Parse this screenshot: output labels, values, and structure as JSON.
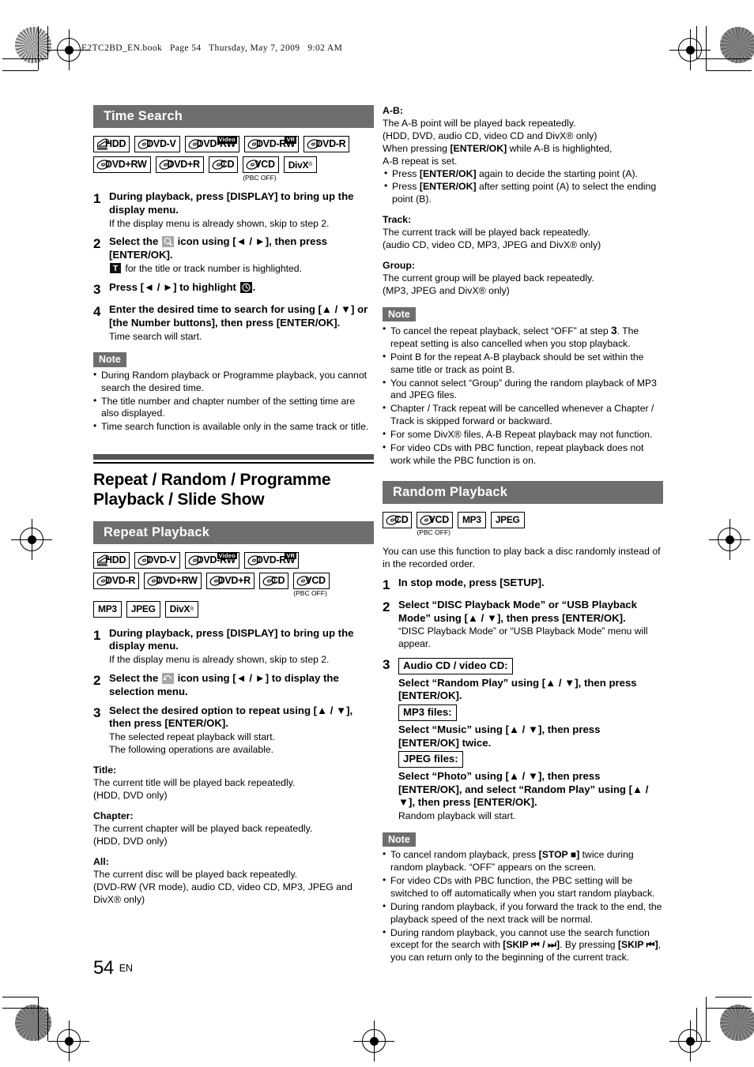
{
  "page": {
    "book_header": "E2TC2BD_EN.book   Page 54   Thursday, May 7, 2009   9:02 AM",
    "number": "54",
    "language": "EN"
  },
  "left_column": {
    "time_search": {
      "heading": "Time Search",
      "badges": [
        [
          {
            "type": "hdd",
            "label": "HDD"
          },
          {
            "type": "disc",
            "label": "DVD-V"
          },
          {
            "type": "disc",
            "label": "DVD-RW",
            "sup": "Video"
          },
          {
            "type": "disc",
            "label": "DVD-RW",
            "sup": "VR"
          },
          {
            "type": "disc",
            "label": "DVD-R"
          }
        ],
        [
          {
            "type": "disc",
            "label": "DVD+RW"
          },
          {
            "type": "disc",
            "label": "DVD+R"
          },
          {
            "type": "disc",
            "label": "CD"
          },
          {
            "type": "disc",
            "label": "VCD",
            "note": "(PBC OFF)"
          },
          {
            "type": "text",
            "label": "DivX",
            "reg": true
          }
        ]
      ],
      "steps": [
        {
          "num": "1",
          "lead": "During playback, press [DISPLAY] to bring up the display menu.",
          "sub": "If the display menu is already shown, skip to step 2."
        },
        {
          "num": "2",
          "lead_pre": "Select the ",
          "icon": "search-icon",
          "lead_post": " icon using [◄ / ►], then press [ENTER/OK].",
          "sub_icon": "title-t-icon",
          "sub_post": " for the title or track number is highlighted."
        },
        {
          "num": "3",
          "lead_pre": "Press [◄ / ►] to highlight ",
          "icon": "clock-icon",
          "lead_post": "."
        },
        {
          "num": "4",
          "lead": "Enter the desired time to search for using [▲ / ▼] or [the Number buttons], then press [ENTER/OK].",
          "sub": "Time search will start."
        }
      ],
      "note_label": "Note",
      "notes": [
        "During Random playback or Programme playback, you cannot search the desired time.",
        "The title number and chapter number of the setting time are also displayed.",
        "Time search function is available only in the same track or title."
      ]
    },
    "chapter": {
      "title": "Repeat / Random / Programme Playback / Slide Show"
    },
    "repeat_playback": {
      "heading": "Repeat Playback",
      "badges": [
        [
          {
            "type": "hdd",
            "label": "HDD"
          },
          {
            "type": "disc",
            "label": "DVD-V"
          },
          {
            "type": "disc",
            "label": "DVD-RW",
            "sup": "Video"
          },
          {
            "type": "disc",
            "label": "DVD-RW",
            "sup": "VR"
          }
        ],
        [
          {
            "type": "disc",
            "label": "DVD-R"
          },
          {
            "type": "disc",
            "label": "DVD+RW"
          },
          {
            "type": "disc",
            "label": "DVD+R"
          },
          {
            "type": "disc",
            "label": "CD"
          },
          {
            "type": "disc",
            "label": "VCD",
            "note": "(PBC OFF)"
          }
        ],
        [
          {
            "type": "text",
            "label": "MP3"
          },
          {
            "type": "text",
            "label": "JPEG"
          },
          {
            "type": "text",
            "label": "DivX",
            "reg": true
          }
        ]
      ],
      "steps": [
        {
          "num": "1",
          "lead": "During playback, press [DISPLAY] to bring up the display menu.",
          "sub": "If the display menu is already shown, skip to step 2."
        },
        {
          "num": "2",
          "lead_pre": "Select the ",
          "icon": "repeat-icon",
          "lead_post": " icon using [◄ / ►] to display the selection menu."
        },
        {
          "num": "3",
          "lead": "Select the desired option to repeat using [▲ / ▼], then press [ENTER/OK].",
          "sub": "The selected repeat playback will start.\nThe following operations are available."
        }
      ],
      "definitions": [
        {
          "term": "Title:",
          "desc": "The current title will be played back repeatedly.\n(HDD, DVD only)"
        },
        {
          "term": "Chapter:",
          "desc": "The current chapter will be played back repeatedly.\n(HDD, DVD only)"
        },
        {
          "term": "All:",
          "desc": "The current disc will be played back repeatedly.\n(DVD-RW (VR mode), audio CD, video CD, MP3, JPEG and DivX® only)"
        }
      ]
    }
  },
  "right_column": {
    "ab_section": {
      "term": "A-B:",
      "lines": [
        "The A-B point will be played back repeatedly.",
        "(HDD, DVD, audio CD, video CD and DivX® only)",
        "When pressing [ENTER/OK] while A-B is highlighted,",
        "A-B repeat is set."
      ],
      "bullets": [
        "Press [ENTER/OK] again to decide the starting point (A).",
        "Press [ENTER/OK] after setting point (A) to select the ending point (B)."
      ]
    },
    "track_section": {
      "term": "Track:",
      "desc": "The current track will be played back repeatedly.\n(audio CD, video CD, MP3, JPEG and DivX® only)"
    },
    "group_section": {
      "term": "Group:",
      "desc": "The current group will be played back repeatedly.\n(MP3, JPEG and DivX® only)"
    },
    "repeat_notes": {
      "note_label": "Note",
      "notes": [
        "To cancel the repeat playback, select “OFF” at step 3. The repeat setting is also cancelled when you stop playback.",
        "Point B for the repeat A-B playback should be set within the same title or track as point B.",
        "You cannot select “Group” during the random playback of MP3 and JPEG files.",
        "Chapter / Track repeat will be cancelled whenever a Chapter / Track is skipped forward or backward.",
        "For some DivX® files, A-B Repeat playback may not function.",
        "For video CDs with PBC function, repeat playback does not work while the PBC function is on."
      ]
    },
    "random_playback": {
      "heading": "Random Playback",
      "badges": [
        [
          {
            "type": "disc",
            "label": "CD"
          },
          {
            "type": "disc",
            "label": "VCD",
            "note": "(PBC OFF)"
          },
          {
            "type": "text",
            "label": "MP3"
          },
          {
            "type": "text",
            "label": "JPEG"
          }
        ]
      ],
      "intro": "You can use this function to play back a disc randomly instead of in the recorded order.",
      "steps": [
        {
          "num": "1",
          "lead": "In stop mode, press [SETUP]."
        },
        {
          "num": "2",
          "lead": "Select “DISC Playback Mode” or “USB Playback Mode” using [▲ / ▼], then press [ENTER/OK].",
          "sub": "“DISC Playback Mode” or “USB Playback Mode” menu will appear."
        },
        {
          "num": "3",
          "groups": [
            {
              "boxed": "Audio CD / video CD:",
              "lead": "Select “Random Play” using [▲ / ▼], then press [ENTER/OK]."
            },
            {
              "boxed": "MP3 files:",
              "lead": "Select “Music” using [▲ / ▼], then press [ENTER/OK] twice."
            },
            {
              "boxed": "JPEG files:",
              "lead": "Select “Photo” using [▲ / ▼], then press [ENTER/OK], and select “Random Play” using [▲ / ▼], then press [ENTER/OK].",
              "sub": "Random playback will start."
            }
          ]
        }
      ],
      "note_label": "Note",
      "notes": [
        "To cancel random playback, press [STOP ■] twice during random playback. “OFF” appears on the screen.",
        "For video CDs with PBC function, the PBC setting will be switched to off automatically when you start random playback.",
        "During random playback, if you forward the track to the end, the playback speed of the next track will be normal.",
        "During random playback, you cannot use the search function except for the search with [SKIP ⏮ / ⏭]. By pressing [SKIP ⏮], you can return only to the beginning of the current track."
      ]
    }
  },
  "colors": {
    "section_bar": "#6e6e6e",
    "note_tag": "#6e6e6e",
    "text": "#000000",
    "page_background": "#ffffff"
  }
}
